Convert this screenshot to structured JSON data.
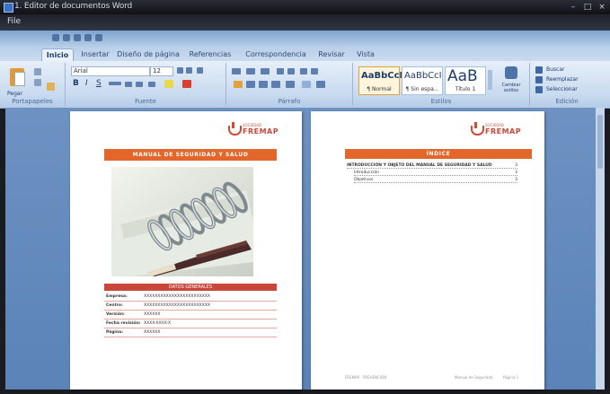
{
  "window": {
    "title": "1. Editor de documentos Word"
  },
  "menu": {
    "file_label": "File"
  },
  "tabs": [
    {
      "label": "Inicio"
    },
    {
      "label": "Insertar"
    },
    {
      "label": "Diseño de página"
    },
    {
      "label": "Referencias"
    },
    {
      "label": "Correspondencia"
    },
    {
      "label": "Revisar"
    },
    {
      "label": "Vista"
    }
  ],
  "ribbon": {
    "paste_label": "Pegar",
    "clipboard_label": "Portapapeles",
    "font_name": "Arial",
    "font_size": "12",
    "font_group_label": "Fuente",
    "paragraph_group_label": "Párrafo",
    "styles_group_label": "Estilos",
    "editing_group_label": "Edición",
    "styles": [
      {
        "preview": "AaBbCcI",
        "label": "¶ Normal"
      },
      {
        "preview": "AaBbCcI",
        "label": "¶ Sin espa..."
      },
      {
        "preview": "AaB",
        "label": "Título 1"
      }
    ],
    "change_styles_label": "Cambiar estilos",
    "find_label": "Buscar",
    "replace_label": "Reemplazar",
    "select_label": "Seleccionar"
  },
  "doc": {
    "logo_top": "SOCIEDAD",
    "logo_name": "FREMAP",
    "cover_title": "MANUAL DE SEGURIDAD Y SALUD",
    "info_header": "DATOS GENERALES",
    "info_rows": [
      {
        "key": "Empresa:",
        "value": "XXXXXXXXXXXXXXXXXXXXXXXX"
      },
      {
        "key": "Centro:",
        "value": "XXXXXXXXXXXXXXXXXXXXXXXX"
      },
      {
        "key": "Versión:",
        "value": "XXXXXX"
      },
      {
        "key": "Fecha revisión:",
        "value": "XXXX-XXXX-X"
      },
      {
        "key": "Página:",
        "value": "XXXXXX"
      }
    ],
    "index_title": "ÍNDICE",
    "toc": [
      {
        "label": "INTRODUCCIÓN Y OBJETO DEL MANUAL DE SEGURIDAD Y SALUD",
        "page": "3",
        "indent": 0
      },
      {
        "label": "Introducción",
        "page": "3",
        "indent": 1
      },
      {
        "label": "Objetivos",
        "page": "3",
        "indent": 1
      }
    ],
    "footer_left": "FREMAP · PREVENCIÓN",
    "footer_mid": "Manual de Seguridad",
    "footer_right": "Página 1"
  },
  "colors": {
    "accent": "#e3672a",
    "brand": "#c8473a",
    "workspace": "#6d92c2"
  }
}
